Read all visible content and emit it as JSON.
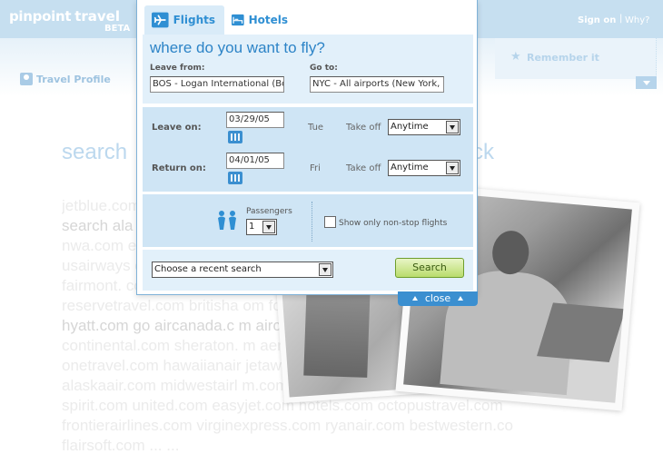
{
  "header": {
    "logo_text": "pinpoint",
    "logo_text2": "travel",
    "beta": "BETA",
    "sign_in": "Sign on",
    "separator": "|",
    "why": "Why?"
  },
  "profile": {
    "label": "Travel Profile"
  },
  "remember": {
    "label": "Remember it"
  },
  "background": {
    "search_left": "search",
    "search_right": "ck",
    "cloud_lines": [
      "jetblue.com                                       rlines",
      "search                                              ala",
      "nwa.com                                            el.com",
      "usairways                                           om",
      "fairmont.                                            com",
      "reservetravel.com  britisha                    om fou",
      "hyatt.com  go  aircanada.c                    m airc",
      "continental.com  sheraton.                     m aerl",
      "onetravel.com  hawaiianair                         jetaw",
      "alaskaair.com  midwestairl                   m.com",
      "spirit.com  united.com  easyjet.com  hotels.com  octopustravel.com",
      "frontierairlines.com  virginexpress.com  ryanair.com  bestwestern.co",
      "flairsoft.com  ...                                          ..."
    ]
  },
  "tabs": {
    "flights": "Flights",
    "hotels": "Hotels"
  },
  "form": {
    "heading": "where do you want to fly?",
    "leave_from_label": "Leave from:",
    "leave_from_value": "BOS - Logan International (Bo",
    "go_to_label": "Go to:",
    "go_to_value": "NYC - All airports (New York,",
    "leave_on_label": "Leave on:",
    "leave_on_value": "03/29/05",
    "leave_day": "Tue",
    "return_on_label": "Return on:",
    "return_on_value": "04/01/05",
    "return_day": "Fri",
    "takeoff_label": "Take off",
    "leave_takeoff": "Anytime",
    "return_takeoff": "Anytime",
    "passengers_label": "Passengers",
    "passengers_value": "1",
    "nonstop_label": "Show only non-stop flights",
    "nonstop_checked": false,
    "recent_search": "Choose a recent search",
    "search_button": "Search"
  },
  "close_tab": {
    "label": "close"
  },
  "colors": {
    "accent": "#2f8fd3",
    "panel_light": "#e2f0fa",
    "panel_mid": "#cfe5f5",
    "search_green": "#b9dc6c"
  }
}
